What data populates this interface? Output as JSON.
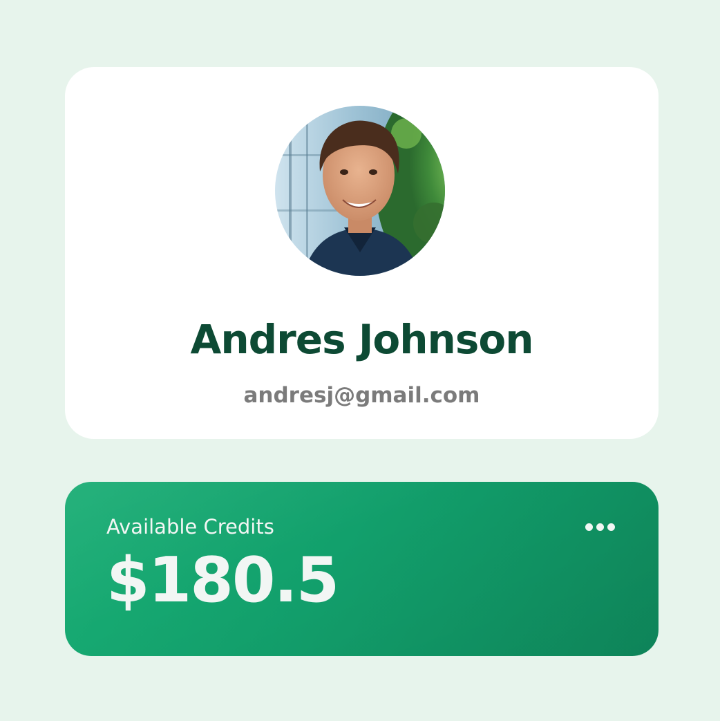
{
  "profile": {
    "name": "Andres Johnson",
    "email": "andresj@gmail.com"
  },
  "credits": {
    "label": "Available Credits",
    "amount": "$180.5",
    "menu_icon": "more-dots-icon"
  },
  "colors": {
    "background": "#e7f4ec",
    "card": "#ffffff",
    "name_text": "#0d4a34",
    "email_text": "#7b7b7b",
    "credits_card": "#13a06c",
    "credits_text": "#f2f6f4"
  }
}
